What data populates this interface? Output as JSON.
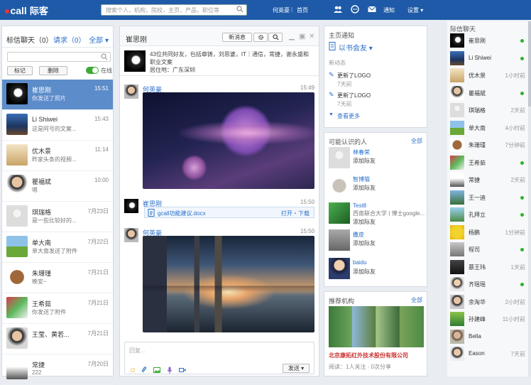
{
  "topbar": {
    "logo": "call",
    "logo_sub": "际客",
    "search_placeholder": "搜索个人，机构，院校，主页，产品，职位等",
    "user_name": "何英豪",
    "home": "首页",
    "notice": "通知",
    "settings": "设置 ▾"
  },
  "chatlist": {
    "title": "标信聊天（0）",
    "requests": "请求（0）",
    "filter": "全部 ▾",
    "btn_mark": "标记",
    "btn_delete": "删除",
    "online": "在线",
    "items": [
      {
        "name": "崔思刚",
        "msg": "你发送了照片",
        "time": "15:51"
      },
      {
        "name": "Li Shiwei",
        "msg": "这是阿号的文案...",
        "time": "15:43"
      },
      {
        "name": "优木景",
        "msg": "昨家头条的视频...",
        "time": "11:14"
      },
      {
        "name": "瞿福斌",
        "msg": "嗯",
        "time": "10:00"
      },
      {
        "name": "琪瑞格",
        "msg": "是一些比较好的...",
        "time": "7月23日"
      },
      {
        "name": "单大南",
        "msg": "单大南发送了附件",
        "time": "7月22日"
      },
      {
        "name": "朱珊瑾",
        "msg": "晚安~",
        "time": "7月21日"
      },
      {
        "name": "王希茹",
        "msg": "你发送了附件",
        "time": "7月21日"
      },
      {
        "name": "王莹、黄若...",
        "msg": "",
        "time": "7月21日"
      },
      {
        "name": "常捷",
        "msg": "222",
        "time": "7月20日"
      }
    ]
  },
  "chat": {
    "title": "崔思刚",
    "new_msg": "新消息",
    "profile": "43位共同好友，包括章铸，刘思婆，IT｜通信，常捷，谢永盛和职业文案",
    "location": "居住地：广东深圳",
    "messages": [
      {
        "name": "何英豪",
        "time": "15:49"
      },
      {
        "name": "崔思刚",
        "time": "15:50"
      },
      {
        "name": "何英豪",
        "time": "15:50"
      }
    ],
    "file_name": "gcall功能建议.docx",
    "file_actions": "打开・下载",
    "reply_placeholder": "回复...",
    "send": "发送"
  },
  "homepage": {
    "title": "主页通知",
    "page_name": "以书会友 ▾",
    "new_label": "新动态",
    "updates": [
      {
        "text": "更新了LOGO",
        "time": "7天前"
      },
      {
        "text": "更新了LOGO",
        "time": "7天前"
      }
    ],
    "more": "查看更多"
  },
  "pymk": {
    "title": "可能认识的人",
    "all": "全部",
    "people": [
      {
        "name": "林春荣",
        "sub": "",
        "add": "添加际友"
      },
      {
        "name": "智博猫",
        "sub": "",
        "add": "添加际友"
      },
      {
        "name": "Test8",
        "sub": "西南联合大学 | 博士google...",
        "add": "添加际友"
      },
      {
        "name": "撒皮",
        "sub": "",
        "add": "添加际友"
      },
      {
        "name": "baidu",
        "sub": "",
        "add": "添加际友"
      }
    ]
  },
  "org": {
    "title": "推荐机构",
    "all": "全部",
    "name": "北京康拓红外技术股份有限公司",
    "meta": "阅读：1人关注 · 0次分享"
  },
  "friends": {
    "title": "际信聊天",
    "items": [
      {
        "name": "崔思刚",
        "time": "",
        "online": true
      },
      {
        "name": "Li Shiwei",
        "time": "",
        "online": true
      },
      {
        "name": "优木景",
        "time": "1小时前",
        "online": false
      },
      {
        "name": "瞿福斌",
        "time": "",
        "online": true
      },
      {
        "name": "琪瑞格",
        "time": "2天前",
        "online": false
      },
      {
        "name": "单大南",
        "time": "4小时前",
        "online": false
      },
      {
        "name": "朱珊瑾",
        "time": "7分钟前",
        "online": false
      },
      {
        "name": "王希茹",
        "time": "",
        "online": true
      },
      {
        "name": "常捷",
        "time": "2天前",
        "online": false
      },
      {
        "name": "王一迪",
        "time": "",
        "online": true
      },
      {
        "name": "孔拜立",
        "time": "",
        "online": true
      },
      {
        "name": "杨鹏",
        "time": "1分钟前",
        "online": false
      },
      {
        "name": "程司",
        "time": "",
        "online": true
      },
      {
        "name": "慕王玮",
        "time": "1天前",
        "online": false
      },
      {
        "name": "齐瑶瑶",
        "time": "",
        "online": true
      },
      {
        "name": "余淘华",
        "time": "2小时前",
        "online": false
      },
      {
        "name": "孙建峰",
        "time": "11小时前",
        "online": false
      },
      {
        "name": "Bella",
        "time": "",
        "online": false
      },
      {
        "name": "Eason",
        "time": "7天前",
        "online": false
      }
    ]
  }
}
